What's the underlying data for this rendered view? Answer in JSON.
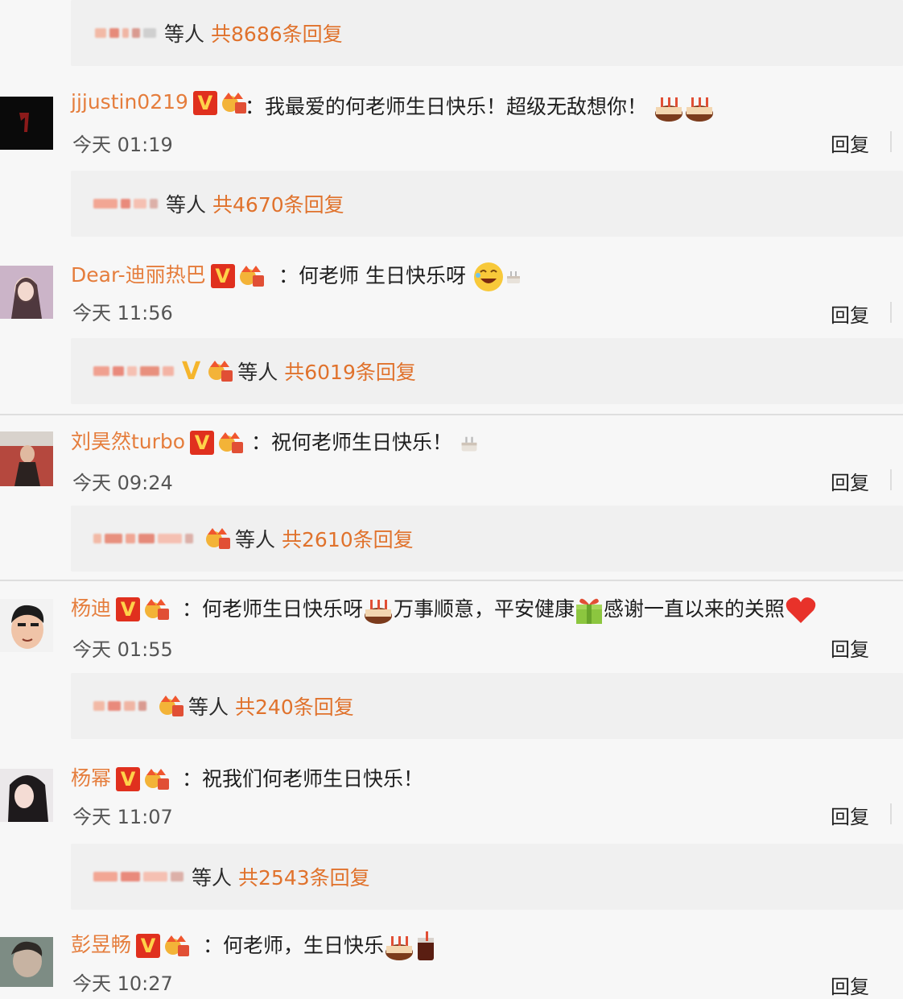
{
  "summaries": [
    {
      "label": "等人",
      "count": "共8686条回复"
    },
    {
      "label": "等人",
      "count": "共4670条回复"
    },
    {
      "label": "等人",
      "count": "共6019条回复"
    },
    {
      "label": "等人",
      "count": "共2610条回复"
    },
    {
      "label": "等人",
      "count": "共240条回复"
    },
    {
      "label": "等人",
      "count": "共2543条回复"
    }
  ],
  "comments": [
    {
      "username": "jjjustin0219",
      "text": "我最爱的何老师生日快乐！超级无敌想你！",
      "time": "今天 01:19",
      "reply_label": "回复"
    },
    {
      "username": "Dear-迪丽热巴",
      "text": "何老师 生日快乐呀",
      "time": "今天 11:56",
      "reply_label": "回复"
    },
    {
      "username": "刘昊然turbo",
      "text": "祝何老师生日快乐！",
      "time": "今天 09:24",
      "reply_label": "回复"
    },
    {
      "username": "杨迪",
      "text_parts": [
        "何老师生日快乐呀",
        "万事顺意，平安健康",
        "感谢一直以来的关照"
      ],
      "time": "今天 01:55",
      "reply_label": "回复"
    },
    {
      "username": "杨幂",
      "text": "祝我们何老师生日快乐！",
      "time": "今天 11:07",
      "reply_label": "回复"
    },
    {
      "username": "彭昱畅",
      "text": "何老师，生日快乐",
      "time": "今天 10:27",
      "reply_label": "回复"
    }
  ],
  "badge_letter": "V",
  "colon": "：",
  "colors": {
    "username": "#e57d3c",
    "reply_count": "#e0722c",
    "v_badge": "#e0301e",
    "background": "#f7f7f7",
    "summary_bg": "#f0f0f0"
  },
  "icons": [
    "v-verified-icon",
    "crown-badge-icon",
    "cake-emoji-icon",
    "laugh-emoji-icon",
    "gift-emoji-icon",
    "heart-emoji-icon",
    "drink-emoji-icon",
    "small-cake-icon"
  ]
}
